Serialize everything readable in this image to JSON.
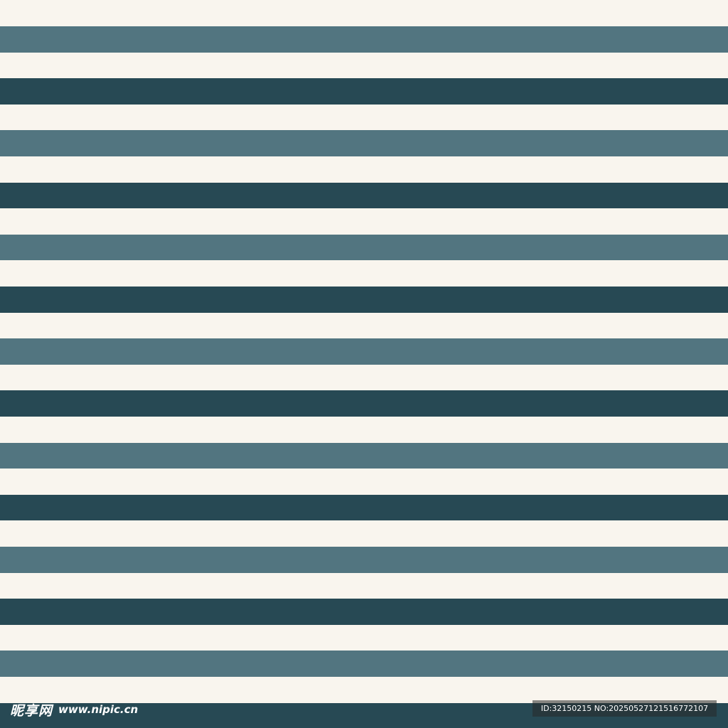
{
  "pattern": {
    "type": "horizontal-stripes",
    "colors": {
      "background": "#f9f5ee",
      "light_stripe": "#527580",
      "dark_stripe": "#274954"
    },
    "stripe_sequence": [
      "light",
      "dark",
      "light",
      "dark",
      "light",
      "dark",
      "light",
      "dark",
      "light",
      "dark",
      "light",
      "dark",
      "light",
      "dark"
    ]
  },
  "watermark": {
    "logo_text": "昵享网",
    "url_text": "www.nipic.cn",
    "id_text": "ID:32150215 NO:20250527121516772107"
  }
}
